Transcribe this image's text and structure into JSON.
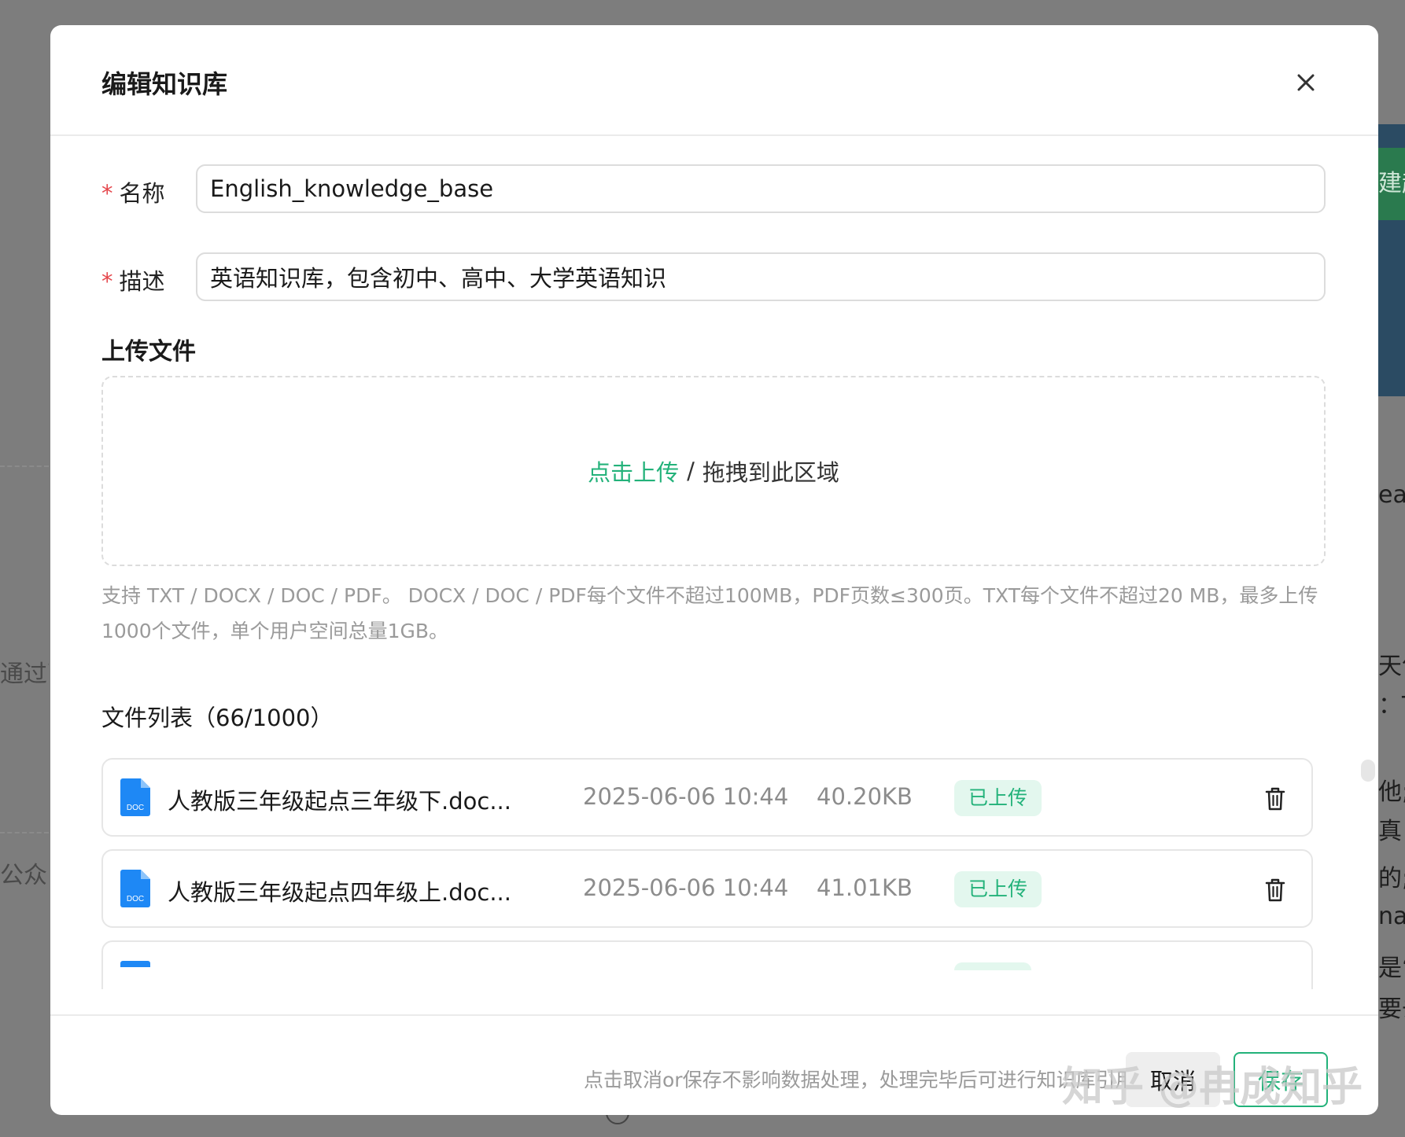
{
  "background": {
    "green_button_fragment": "建起",
    "right_fragments": [
      "eat",
      "天气",
      "：T",
      "他;",
      "真",
      "的;",
      "nas",
      "是“个",
      "要去"
    ],
    "left_fragments": [
      "通过可",
      "公众"
    ]
  },
  "modal": {
    "title": "编辑知识库",
    "close_icon": "close-icon",
    "form": {
      "name": {
        "label": "名称",
        "required_mark": "*",
        "value": "English_knowledge_base"
      },
      "description": {
        "label": "描述",
        "required_mark": "*",
        "value": "英语知识库，包含初中、高中、大学英语知识"
      }
    },
    "upload": {
      "section_title": "上传文件",
      "click_text": "点击上传",
      "separator": "/",
      "drag_text": "拖拽到此区域",
      "hint": "支持 TXT / DOCX / DOC / PDF。 DOCX / DOC / PDF每个文件不超过100MB，PDF页数≤300页。TXT每个文件不超过20 MB，最多上传1000个文件，单个用户空间总量1GB。"
    },
    "file_list": {
      "title": "文件列表（66/1000）",
      "files": [
        {
          "icon": "doc-file-icon",
          "icon_label": "DOC",
          "name": "人教版三年级起点三年级下.doc...",
          "date": "2025-06-06 10:44",
          "size": "40.20KB",
          "status": "已上传"
        },
        {
          "icon": "doc-file-icon",
          "icon_label": "DOC",
          "name": "人教版三年级起点四年级上.doc...",
          "date": "2025-06-06 10:44",
          "size": "41.01KB",
          "status": "已上传"
        }
      ]
    },
    "footer": {
      "note": "点击取消or保存不影响数据处理，处理完毕后可进行知识库引用",
      "cancel_label": "取消",
      "save_label": "保存"
    }
  },
  "watermark": "知乎 @冉成知乎",
  "colors": {
    "accent": "#23b27a",
    "status_bg": "#e3f7ee",
    "required": "#e5484d",
    "doc_icon": "#1e88f5",
    "overlay": "#7d7d7d"
  }
}
